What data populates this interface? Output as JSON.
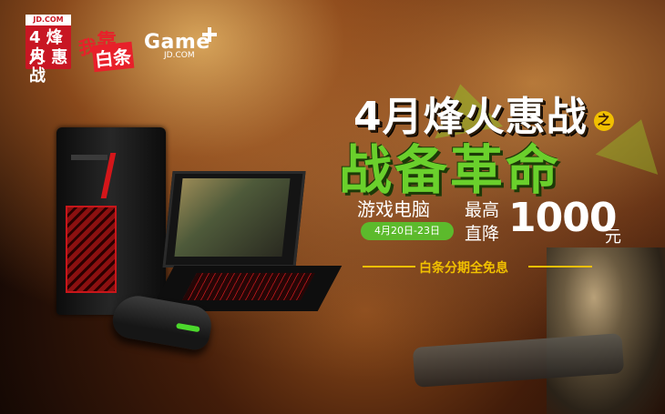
{
  "logos": {
    "jd_top": "JD.COM",
    "jd_line1": "4 烽火",
    "jd_line2": "月 惠战",
    "baitiao_1": "我",
    "baitiao_2": "靠",
    "baitiao_3": "白条",
    "game_main": "Game",
    "game_sub": "JD.COM"
  },
  "headline": "4月烽火惠战",
  "headline_suffix": "之",
  "subheadline": "战备革命",
  "promo": {
    "category": "游戏电脑",
    "date_range": "4月20日-23日",
    "max_label_1": "最高",
    "max_label_2": "直降",
    "amount": "1000",
    "currency": "元",
    "interest_free": "白条分期全免息"
  },
  "colors": {
    "accent_green": "#6ad02c",
    "accent_yellow": "#f1c000",
    "jd_red": "#c81623"
  }
}
